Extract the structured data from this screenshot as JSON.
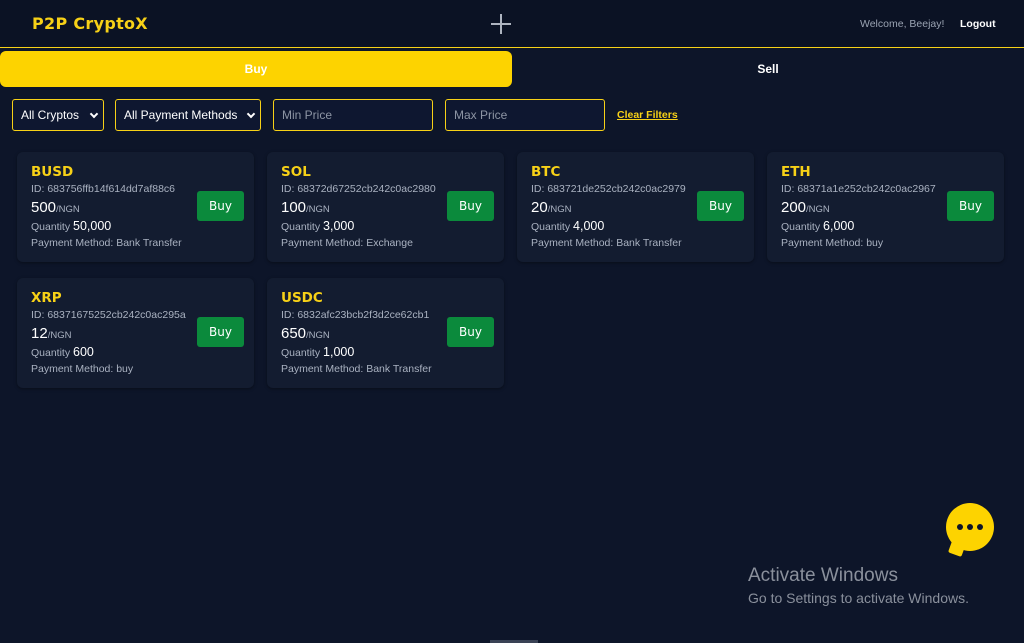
{
  "header": {
    "logo": "P2P CryptoX",
    "welcome": "Welcome, Beejay!",
    "logout": "Logout"
  },
  "tabs": {
    "buy": "Buy",
    "sell": "Sell",
    "active": "buy"
  },
  "filters": {
    "crypto_selected": "All Cryptos",
    "payment_selected": "All Payment Methods",
    "min_price_placeholder": "Min Price",
    "max_price_placeholder": "Max Price",
    "clear": "Clear Filters"
  },
  "offers": [
    {
      "symbol": "BUSD",
      "id": "ID: 683756ffb14f614dd7af88c6",
      "price": "500",
      "unit": "/NGN",
      "quantity_label": "Quantity",
      "quantity": "50,000",
      "payment": "Payment Method: Bank Transfer",
      "button": "Buy"
    },
    {
      "symbol": "SOL",
      "id": "ID: 68372d67252cb242c0ac2980",
      "price": "100",
      "unit": "/NGN",
      "quantity_label": "Quantity",
      "quantity": "3,000",
      "payment": "Payment Method: Exchange",
      "button": "Buy"
    },
    {
      "symbol": "BTC",
      "id": "ID: 683721de252cb242c0ac2979",
      "price": "20",
      "unit": "/NGN",
      "quantity_label": "Quantity",
      "quantity": "4,000",
      "payment": "Payment Method: Bank Transfer",
      "button": "Buy"
    },
    {
      "symbol": "ETH",
      "id": "ID: 68371a1e252cb242c0ac2967",
      "price": "200",
      "unit": "/NGN",
      "quantity_label": "Quantity",
      "quantity": "6,000",
      "payment": "Payment Method: buy",
      "button": "Buy"
    },
    {
      "symbol": "XRP",
      "id": "ID: 68371675252cb242c0ac295a",
      "price": "12",
      "unit": "/NGN",
      "quantity_label": "Quantity",
      "quantity": "600",
      "payment": "Payment Method: buy",
      "button": "Buy"
    },
    {
      "symbol": "USDC",
      "id": "ID: 6832afc23bcb2f3d2ce62cb1",
      "price": "650",
      "unit": "/NGN",
      "quantity_label": "Quantity",
      "quantity": "1,000",
      "payment": "Payment Method: Bank Transfer",
      "button": "Buy"
    }
  ],
  "watermark": {
    "title": "Activate Windows",
    "subtitle": "Go to Settings to activate Windows."
  },
  "icons": {
    "add": "plus-icon",
    "chat": "chat-bubble-icon",
    "dropdown": "chevron-down-icon"
  },
  "colors": {
    "accent": "#fdd300",
    "background": "#0d1529",
    "card": "#131c30",
    "buy_button": "#0b8a3c"
  }
}
